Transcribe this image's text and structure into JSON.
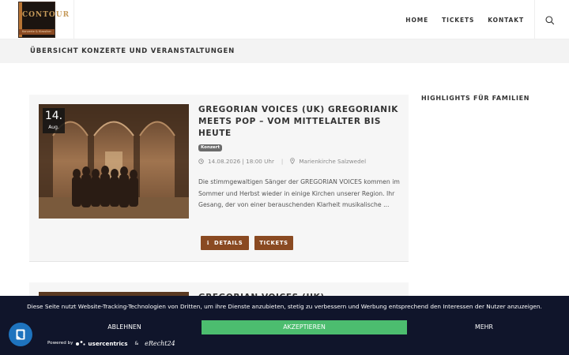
{
  "header": {
    "logo_text": "CONTOUR",
    "logo_subtext": "Konzerte & Klassiker",
    "nav": [
      {
        "label": "HOME"
      },
      {
        "label": "TICKETS"
      },
      {
        "label": "KONTAKT"
      }
    ],
    "search_icon": "search-icon"
  },
  "page_title": "ÜBERSICHT KONZERTE UND VERANSTALTUNGEN",
  "events": [
    {
      "date_day": "14.",
      "date_month": "Aug.",
      "title": "GREGORIAN VOICES (UK) GREGORIANIK MEETS POP – VOM MITTELALTER BIS HEUTE",
      "category": "Konzert",
      "datetime": "14.08.2026 | 18:00 Uhr",
      "location": "Marienkirche Salzwedel",
      "excerpt": "Die stimmgewaltigen Sänger der GREGORIAN VOICES kommen im Sommer und Herbst wieder in einige Kirchen unserer Region. Ihr Gesang, der von einer berauschenden Klarheit musikalische ...",
      "details_label": "DETAILS",
      "tickets_label": "TICKETS"
    },
    {
      "title": "GREGORIAN VOICES (UK)"
    }
  ],
  "sidebar": {
    "title": "HIGHLIGHTS FÜR FAMILIEN"
  },
  "cookie_banner": {
    "text": "Diese Seite nutzt Website-Tracking-Technologien von Dritten, um ihre Dienste anzubieten, stetig zu verbessern und Werbung entsprechend den Interessen der Nutzer anzuzeigen.",
    "reject_label": "ABLEHNEN",
    "accept_label": "AKZEPTIEREN",
    "more_label": "MEHR",
    "powered_by": "Powered by",
    "usercentrics": "usercentrics",
    "amp": "&",
    "erecht24": "eRecht24"
  },
  "colors": {
    "accent": "#8a4a22",
    "accept": "#4cbd6f",
    "banner": "#10152b",
    "fab": "#1e73be"
  }
}
